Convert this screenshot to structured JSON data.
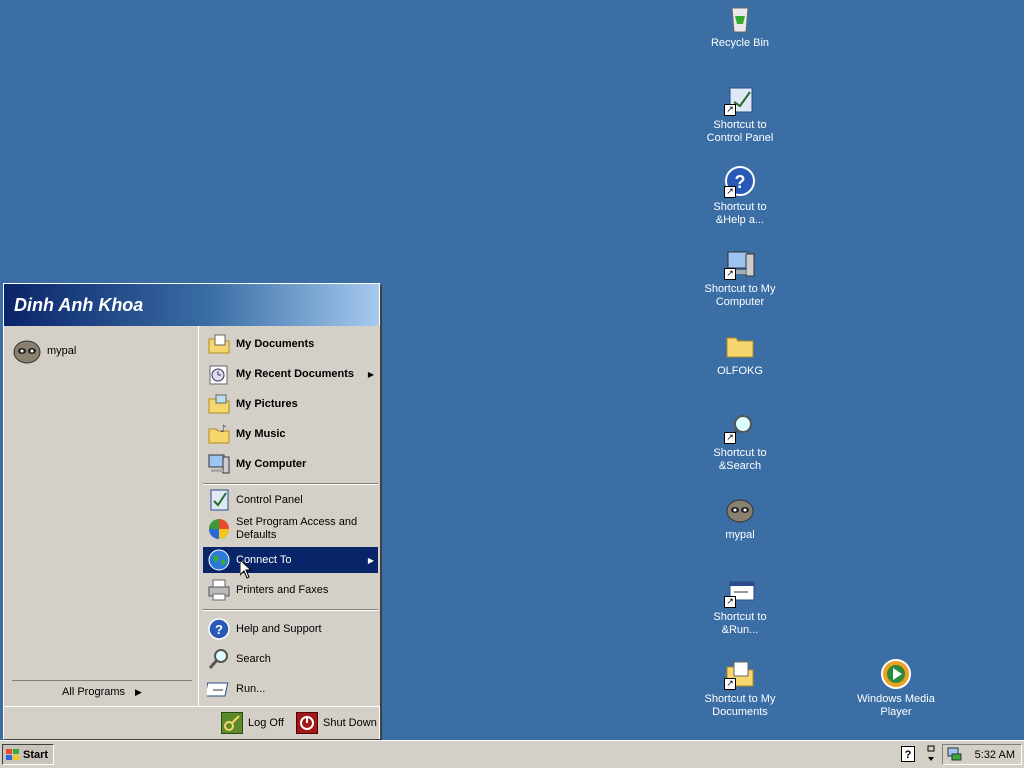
{
  "desktop": {
    "icons": [
      {
        "label": "Recycle Bin",
        "icon": "recycle-bin-icon"
      },
      {
        "label": "Shortcut to Control Panel",
        "icon": "control-panel-icon"
      },
      {
        "label": "Shortcut to &Help a...",
        "icon": "help-icon"
      },
      {
        "label": "Shortcut to My Computer",
        "icon": "my-computer-icon"
      },
      {
        "label": "OLFOKG",
        "icon": "folder-icon"
      },
      {
        "label": "Shortcut to &Search",
        "icon": "search-icon"
      },
      {
        "label": "mypal",
        "icon": "mypal-raccoon-icon"
      },
      {
        "label": "Shortcut to &Run...",
        "icon": "run-icon"
      },
      {
        "label": "Shortcut to My Documents",
        "icon": "my-documents-icon"
      },
      {
        "label": "Windows Media Player",
        "icon": "media-player-icon"
      }
    ]
  },
  "start_menu": {
    "user_name": "Dinh Anh Khoa",
    "pinned": [
      {
        "label": "mypal",
        "icon": "mypal-raccoon-icon"
      }
    ],
    "all_programs": "All Programs",
    "right": {
      "my_documents": "My Documents",
      "my_recent_documents": "My Recent Documents",
      "my_pictures": "My Pictures",
      "my_music": "My Music",
      "my_computer": "My Computer",
      "control_panel": "Control Panel",
      "set_program_access": "Set Program Access and Defaults",
      "connect_to": "Connect To",
      "printers_and_faxes": "Printers and Faxes",
      "help_and_support": "Help and Support",
      "search": "Search",
      "run": "Run..."
    },
    "log_off": "Log Off",
    "shut_down": "Shut Down"
  },
  "taskbar": {
    "start_label": "Start",
    "clock": "5:32 AM"
  },
  "colors": {
    "desktop": "#3a6ea5",
    "highlight": "#0a246a",
    "face": "#d4d0c8"
  }
}
